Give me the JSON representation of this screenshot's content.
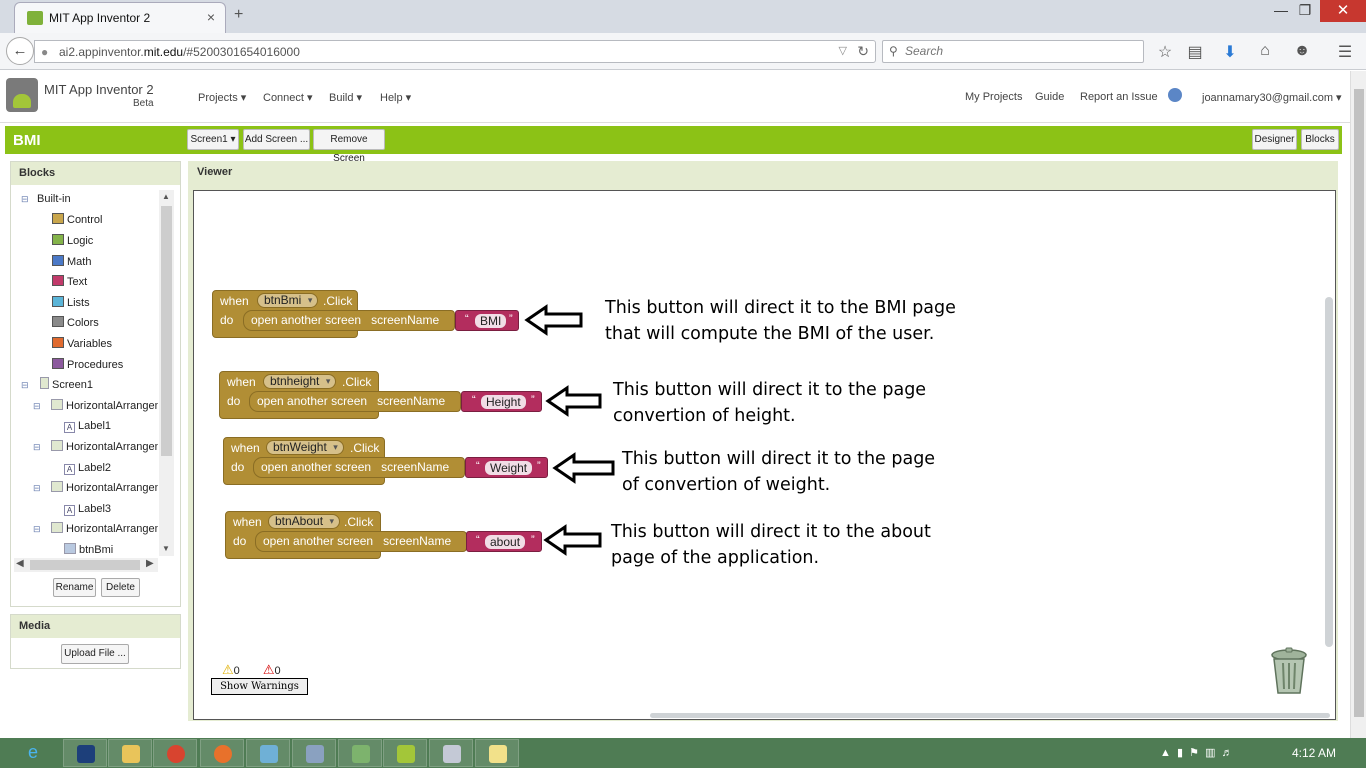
{
  "browser": {
    "tab_title": "MIT App Inventor 2",
    "url_prefix": "ai2.appinventor.",
    "url_domain": "mit.edu",
    "url_suffix": "/#5200301654016000",
    "search_placeholder": "Search",
    "new_tab": "+",
    "close_tab": "×"
  },
  "app": {
    "name": "MIT App Inventor 2",
    "beta": "Beta",
    "menu": [
      "Projects ▾",
      "Connect ▾",
      "Build ▾",
      "Help ▾"
    ],
    "right_menu": [
      "My Projects",
      "Guide",
      "Report an Issue"
    ],
    "user": "joannamary30@gmail.com ▾"
  },
  "project": {
    "name": "BMI",
    "screen_select": "Screen1 ▾",
    "add_screen": "Add Screen ...",
    "remove_screen": "Remove Screen",
    "designer": "Designer",
    "blocks": "Blocks"
  },
  "blocks_panel": {
    "title": "Blocks",
    "builtin": "Built-in",
    "categories": [
      {
        "label": "Control",
        "color": "#c9a64c"
      },
      {
        "label": "Logic",
        "color": "#84b34a"
      },
      {
        "label": "Math",
        "color": "#4b79c7"
      },
      {
        "label": "Text",
        "color": "#c13a6a"
      },
      {
        "label": "Lists",
        "color": "#5bb5d8"
      },
      {
        "label": "Colors",
        "color": "#8a8a8a"
      },
      {
        "label": "Variables",
        "color": "#e06a2f"
      },
      {
        "label": "Procedures",
        "color": "#8c5a9e"
      }
    ],
    "screen": "Screen1",
    "components": [
      {
        "arr": "HorizontalArrangeme",
        "label": "Label1"
      },
      {
        "arr": "HorizontalArrangeme",
        "label": "Label2"
      },
      {
        "arr": "HorizontalArrangeme",
        "label": "Label3"
      },
      {
        "arr": "HorizontalArrangeme",
        "label": "btnBmi"
      }
    ],
    "rename": "Rename",
    "delete": "Delete"
  },
  "media": {
    "title": "Media",
    "upload": "Upload File ..."
  },
  "viewer": {
    "title": "Viewer",
    "when": "when",
    "do": "do",
    "click": ".Click",
    "open_screen": "open another screen",
    "screen_name": "screenName",
    "quote": "“",
    "quote_close": "”",
    "events": [
      {
        "button": "btnBmi",
        "value": "BMI",
        "note": [
          "This button will direct it to the BMI page",
          "that will compute the BMI of the user."
        ]
      },
      {
        "button": "btnheight",
        "value": "Height",
        "note": [
          "This button will direct it to the page",
          "convertion of height."
        ]
      },
      {
        "button": "btnWeight",
        "value": "Weight",
        "note": [
          "This button will direct it to the page",
          "of convertion of weight."
        ]
      },
      {
        "button": "btnAbout",
        "value": "about",
        "note": [
          "This button will direct it to the about",
          "page of the application."
        ]
      }
    ],
    "warnings_count": "0",
    "errors_count": "0",
    "show_warnings": "Show Warnings"
  },
  "taskbar": {
    "clock": "4:12 AM"
  }
}
